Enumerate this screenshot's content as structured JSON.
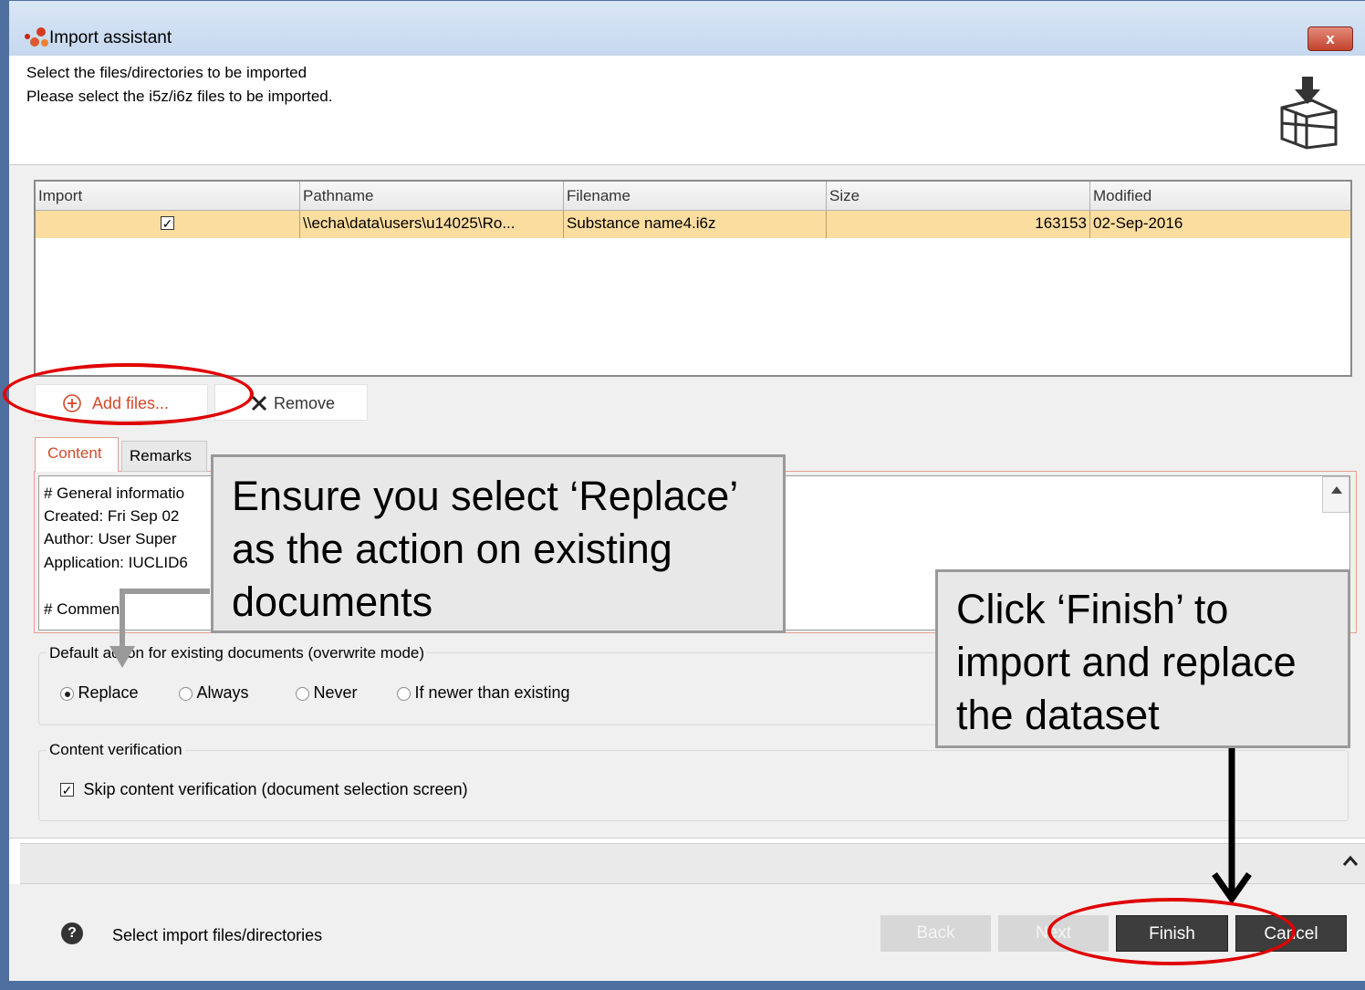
{
  "window": {
    "title": "Import assistant",
    "close_glyph": "x"
  },
  "header": {
    "line1": "Select the files/directories to be imported",
    "line2": "Please select the i5z/i6z files to be imported.",
    "icon": "import-box-icon"
  },
  "table": {
    "columns": [
      "Import",
      "Pathname",
      "Filename",
      "Size",
      "Modified"
    ],
    "rows": [
      {
        "import_checked": true,
        "pathname": "\\\\echa\\data\\users\\u14025\\Ro...",
        "filename": "Substance name4.i6z",
        "size": "163153",
        "modified": "02-Sep-2016"
      }
    ]
  },
  "toolbar": {
    "add_label": "Add files...",
    "remove_label": "Remove"
  },
  "tabs": [
    "Content",
    "Remarks"
  ],
  "content_lines": [
    "# General informatio",
    "Created: Fri Sep 02",
    "Author: User Super",
    "Application: IUCLID6",
    "",
    "# Comment"
  ],
  "default_action": {
    "legend": "Default action for existing documents (overwrite mode)",
    "options": [
      "Replace",
      "Always",
      "Never",
      "If newer than existing"
    ],
    "selected": "Replace"
  },
  "verification": {
    "legend": "Content verification",
    "checkbox_label": "Skip content verification (document selection screen)",
    "checked": true
  },
  "footer": {
    "status": "Select import files/directories",
    "buttons": {
      "back": "Back",
      "next": "Next",
      "finish": "Finish",
      "cancel": "Cancel"
    }
  },
  "callouts": {
    "replace": "Ensure you select ‘Replace’ as the action on existing documents",
    "finish": "Click ‘Finish’ to import and replace the dataset"
  },
  "colors": {
    "title_bar": "#c6d8ef",
    "selected_row": "#fcdda0",
    "accent_red": "#d24a2a",
    "annotation_red": "#e00000",
    "button_dark": "#3d3d3d"
  }
}
